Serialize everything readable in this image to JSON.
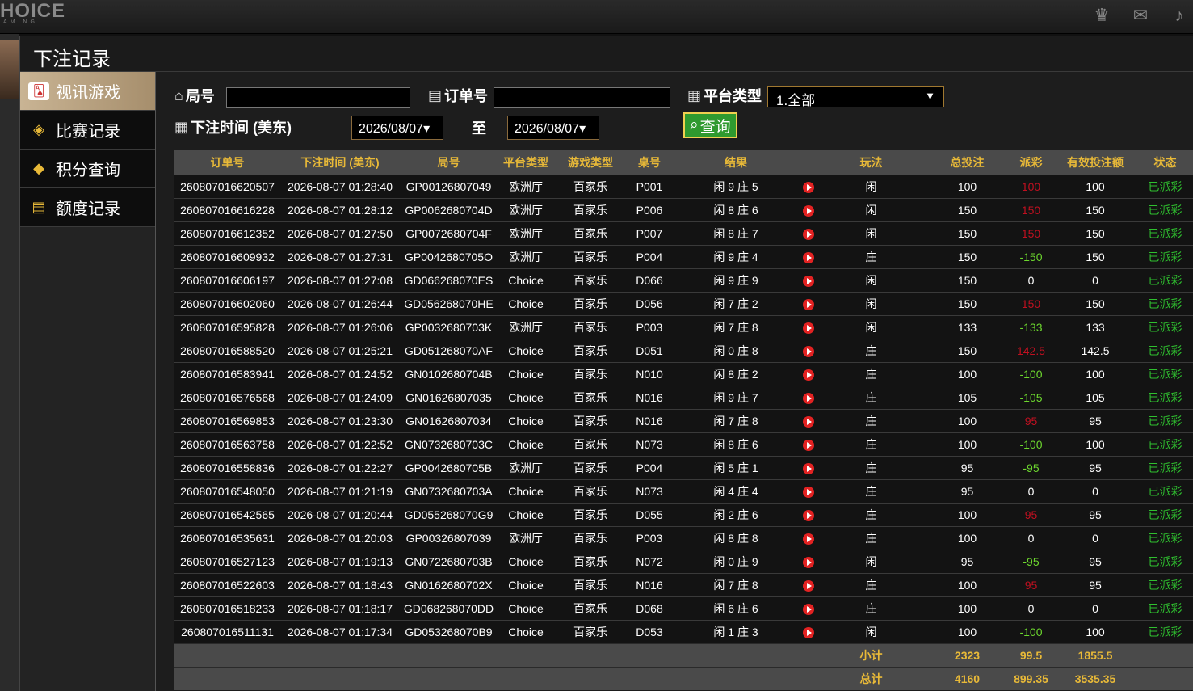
{
  "topbar": {
    "logo": "HOICE",
    "logo_sub": "AMING"
  },
  "panel": {
    "title": "下注记录"
  },
  "sidebar": {
    "items": [
      {
        "label": "视讯游戏",
        "icon": "cards-icon"
      },
      {
        "label": "比赛记录",
        "icon": "tag-icon"
      },
      {
        "label": "积分查询",
        "icon": "diamond-icon"
      },
      {
        "label": "额度记录",
        "icon": "document-icon"
      }
    ]
  },
  "filters": {
    "round_label": "局号",
    "order_label": "订单号",
    "platform_label": "平台类型",
    "platform_value": "1.全部",
    "time_label": "下注时间 (美东)",
    "date_from": "2026/08/07",
    "to_label": "至",
    "date_to": "2026/08/07",
    "query_label": "查询"
  },
  "table": {
    "headers": [
      "订单号",
      "下注时间 (美东)",
      "局号",
      "平台类型",
      "游戏类型",
      "桌号",
      "结果",
      "",
      "玩法",
      "总投注",
      "派彩",
      "有效投注额",
      "状态"
    ],
    "rows": [
      [
        "260807016620507",
        "2026-08-07 01:28:40",
        "GP00126807049",
        "欧洲厅",
        "百家乐",
        "P001",
        "闲 9 庄 5",
        "闲",
        "100",
        "100",
        "red",
        "100",
        "已派彩"
      ],
      [
        "260807016616228",
        "2026-08-07 01:28:12",
        "GP0062680704D",
        "欧洲厅",
        "百家乐",
        "P006",
        "闲 8 庄 6",
        "闲",
        "150",
        "150",
        "red",
        "150",
        "已派彩"
      ],
      [
        "260807016612352",
        "2026-08-07 01:27:50",
        "GP0072680704F",
        "欧洲厅",
        "百家乐",
        "P007",
        "闲 8 庄 7",
        "闲",
        "150",
        "150",
        "red",
        "150",
        "已派彩"
      ],
      [
        "260807016609932",
        "2026-08-07 01:27:31",
        "GP0042680705O",
        "欧洲厅",
        "百家乐",
        "P004",
        "闲 9 庄 4",
        "庄",
        "150",
        "-150",
        "green",
        "150",
        "已派彩"
      ],
      [
        "260807016606197",
        "2026-08-07 01:27:08",
        "GD066268070ES",
        "Choice",
        "百家乐",
        "D066",
        "闲 9 庄 9",
        "闲",
        "150",
        "0",
        "white",
        "0",
        "已派彩"
      ],
      [
        "260807016602060",
        "2026-08-07 01:26:44",
        "GD056268070HE",
        "Choice",
        "百家乐",
        "D056",
        "闲 7 庄 2",
        "闲",
        "150",
        "150",
        "red",
        "150",
        "已派彩"
      ],
      [
        "260807016595828",
        "2026-08-07 01:26:06",
        "GP0032680703K",
        "欧洲厅",
        "百家乐",
        "P003",
        "闲 7 庄 8",
        "闲",
        "133",
        "-133",
        "green",
        "133",
        "已派彩"
      ],
      [
        "260807016588520",
        "2026-08-07 01:25:21",
        "GD051268070AF",
        "Choice",
        "百家乐",
        "D051",
        "闲 0 庄 8",
        "庄",
        "150",
        "142.5",
        "red",
        "142.5",
        "已派彩"
      ],
      [
        "260807016583941",
        "2026-08-07 01:24:52",
        "GN0102680704B",
        "Choice",
        "百家乐",
        "N010",
        "闲 8 庄 2",
        "庄",
        "100",
        "-100",
        "green",
        "100",
        "已派彩"
      ],
      [
        "260807016576568",
        "2026-08-07 01:24:09",
        "GN01626807035",
        "Choice",
        "百家乐",
        "N016",
        "闲 9 庄 7",
        "庄",
        "105",
        "-105",
        "green",
        "105",
        "已派彩"
      ],
      [
        "260807016569853",
        "2026-08-07 01:23:30",
        "GN01626807034",
        "Choice",
        "百家乐",
        "N016",
        "闲 7 庄 8",
        "庄",
        "100",
        "95",
        "red",
        "95",
        "已派彩"
      ],
      [
        "260807016563758",
        "2026-08-07 01:22:52",
        "GN0732680703C",
        "Choice",
        "百家乐",
        "N073",
        "闲 8 庄 6",
        "庄",
        "100",
        "-100",
        "green",
        "100",
        "已派彩"
      ],
      [
        "260807016558836",
        "2026-08-07 01:22:27",
        "GP0042680705B",
        "欧洲厅",
        "百家乐",
        "P004",
        "闲 5 庄 1",
        "庄",
        "95",
        "-95",
        "green",
        "95",
        "已派彩"
      ],
      [
        "260807016548050",
        "2026-08-07 01:21:19",
        "GN0732680703A",
        "Choice",
        "百家乐",
        "N073",
        "闲 4 庄 4",
        "庄",
        "95",
        "0",
        "white",
        "0",
        "已派彩"
      ],
      [
        "260807016542565",
        "2026-08-07 01:20:44",
        "GD055268070G9",
        "Choice",
        "百家乐",
        "D055",
        "闲 2 庄 6",
        "庄",
        "100",
        "95",
        "red",
        "95",
        "已派彩"
      ],
      [
        "260807016535631",
        "2026-08-07 01:20:03",
        "GP00326807039",
        "欧洲厅",
        "百家乐",
        "P003",
        "闲 8 庄 8",
        "庄",
        "100",
        "0",
        "white",
        "0",
        "已派彩"
      ],
      [
        "260807016527123",
        "2026-08-07 01:19:13",
        "GN0722680703B",
        "Choice",
        "百家乐",
        "N072",
        "闲 0 庄 9",
        "闲",
        "95",
        "-95",
        "green",
        "95",
        "已派彩"
      ],
      [
        "260807016522603",
        "2026-08-07 01:18:43",
        "GN0162680702X",
        "Choice",
        "百家乐",
        "N016",
        "闲 7 庄 8",
        "庄",
        "100",
        "95",
        "red",
        "95",
        "已派彩"
      ],
      [
        "260807016518233",
        "2026-08-07 01:18:17",
        "GD068268070DD",
        "Choice",
        "百家乐",
        "D068",
        "闲 6 庄 6",
        "庄",
        "100",
        "0",
        "white",
        "0",
        "已派彩"
      ],
      [
        "260807016511131",
        "2026-08-07 01:17:34",
        "GD053268070B9",
        "Choice",
        "百家乐",
        "D053",
        "闲 1 庄 3",
        "闲",
        "100",
        "-100",
        "green",
        "100",
        "已派彩"
      ]
    ],
    "subtotal": {
      "label": "小计",
      "total": "2323",
      "payout": "99.5",
      "valid": "1855.5"
    },
    "grandtotal": {
      "label": "总计",
      "total": "4160",
      "payout": "899.35",
      "valid": "3535.35"
    }
  }
}
